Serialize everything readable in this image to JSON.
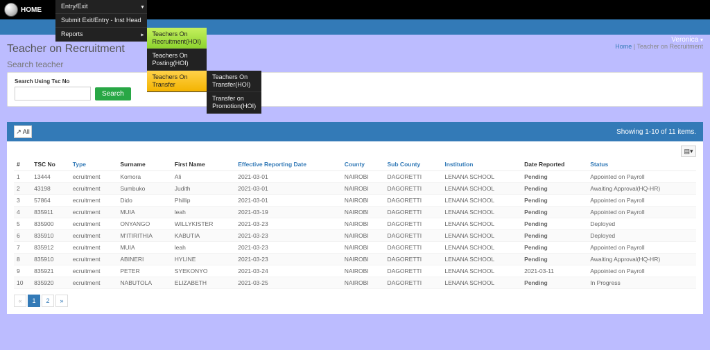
{
  "nav": {
    "home": "HOME",
    "entry_exit": "Entry/Exit",
    "submit_exit_entry": "Submit Exit/Entry - Inst Head",
    "reports": "Reports",
    "reports_sub": {
      "recruitment": "Teachers On Recruitment(HOI)",
      "posting": "Teachers On Posting(HOI)",
      "transfer": "Teachers On Transfer",
      "transfer_hoi": "Teachers On Transfer(HOI)",
      "promotion": "Transfer on Promotion(HOI)"
    }
  },
  "user": {
    "name": "Veronica",
    "caret": "▾"
  },
  "page": {
    "title": "Teacher on Recruitment",
    "breadcrumb_home": "Home",
    "breadcrumb_sep": "|",
    "breadcrumb_current": "Teacher on Recruitment"
  },
  "search": {
    "heading": "Search teacher",
    "field_label": "Search Using Tsc No",
    "placeholder": "",
    "button": "Search"
  },
  "grid": {
    "expand": "↗ All",
    "summary": "Showing 1-10 of 11 items.",
    "export": "▤▾",
    "headers": {
      "idx": "#",
      "tsc_no": "TSC No",
      "type": "Type",
      "surname": "Surname",
      "first_name": "First Name",
      "eff_date": "Effective Reporting Date",
      "county": "County",
      "sub_county": "Sub County",
      "institution": "Institution",
      "date_reported": "Date Reported",
      "status": "Status"
    },
    "rows": [
      {
        "idx": "1",
        "tsc": "13444",
        "type": "ecruitment",
        "surname": "Komora",
        "first": "Ali",
        "eff": "2021-03-01",
        "county": "NAIROBI",
        "sub": "DAGORETTI",
        "inst": "LENANA SCHOOL",
        "dr": "Pending",
        "dr_pending": true,
        "status": "Appointed on Payroll"
      },
      {
        "idx": "2",
        "tsc": "43198",
        "type": "ecruitment",
        "surname": "Sumbuko",
        "first": "Judith",
        "eff": "2021-03-01",
        "county": "NAIROBI",
        "sub": "DAGORETTI",
        "inst": "LENANA SCHOOL",
        "dr": "Pending",
        "dr_pending": true,
        "status": "Awaiting Approval(HQ-HR)"
      },
      {
        "idx": "3",
        "tsc": "57864",
        "type": "ecruitment",
        "surname": "Dido",
        "first": "Phillip",
        "eff": "2021-03-01",
        "county": "NAIROBI",
        "sub": "DAGORETTI",
        "inst": "LENANA SCHOOL",
        "dr": "Pending",
        "dr_pending": true,
        "status": "Appointed on Payroll"
      },
      {
        "idx": "4",
        "tsc": "835911",
        "type": "ecruitment",
        "surname": "MUIA",
        "first": "leah",
        "eff": "2021-03-19",
        "county": "NAIROBI",
        "sub": "DAGORETTI",
        "inst": "LENANA SCHOOL",
        "dr": "Pending",
        "dr_pending": true,
        "status": "Appointed on Payroll"
      },
      {
        "idx": "5",
        "tsc": "835900",
        "type": "ecruitment",
        "surname": "ONYANGO",
        "first": "WILLYKISTER",
        "eff": "2021-03-23",
        "county": "NAIROBI",
        "sub": "DAGORETTI",
        "inst": "LENANA SCHOOL",
        "dr": "Pending",
        "dr_pending": true,
        "status": "Deployed"
      },
      {
        "idx": "6",
        "tsc": "835910",
        "type": "ecruitment",
        "surname": "M'ITIRITHIA",
        "first": "KABUTIA",
        "eff": "2021-03-23",
        "county": "NAIROBI",
        "sub": "DAGORETTI",
        "inst": "LENANA SCHOOL",
        "dr": "Pending",
        "dr_pending": true,
        "status": "Deployed"
      },
      {
        "idx": "7",
        "tsc": "835912",
        "type": "ecruitment",
        "surname": "MUIA",
        "first": "leah",
        "eff": "2021-03-23",
        "county": "NAIROBI",
        "sub": "DAGORETTI",
        "inst": "LENANA SCHOOL",
        "dr": "Pending",
        "dr_pending": true,
        "status": "Appointed on Payroll"
      },
      {
        "idx": "8",
        "tsc": "835910",
        "type": "ecruitment",
        "surname": "ABINERI",
        "first": "HYLINE",
        "eff": "2021-03-23",
        "county": "NAIROBI",
        "sub": "DAGORETTI",
        "inst": "LENANA SCHOOL",
        "dr": "Pending",
        "dr_pending": true,
        "status": "Awaiting Approval(HQ-HR)"
      },
      {
        "idx": "9",
        "tsc": "835921",
        "type": "ecruitment",
        "surname": "PETER",
        "first": "SYEKONYO",
        "eff": "2021-03-24",
        "county": "NAIROBI",
        "sub": "DAGORETTI",
        "inst": "LENANA SCHOOL",
        "dr": "2021-03-11",
        "dr_pending": false,
        "status": "Appointed on Payroll"
      },
      {
        "idx": "10",
        "tsc": "835920",
        "type": "ecruitment",
        "surname": "NABUTOLA",
        "first": "ELIZABETH",
        "eff": "2021-03-25",
        "county": "NAIROBI",
        "sub": "DAGORETTI",
        "inst": "LENANA SCHOOL",
        "dr": "Pending",
        "dr_pending": true,
        "status": "In Progress"
      }
    ],
    "pagination": {
      "prev": "«",
      "p1": "1",
      "p2": "2",
      "next": "»"
    }
  }
}
